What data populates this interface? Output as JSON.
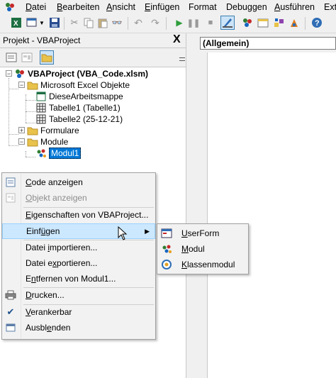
{
  "menubar": {
    "items": [
      {
        "label": "Datei",
        "u": "D",
        "rest": "atei"
      },
      {
        "label": "Bearbeiten",
        "u": "B",
        "rest": "earbeiten"
      },
      {
        "label": "Ansicht",
        "u": "A",
        "rest": "nsicht"
      },
      {
        "label": "Einfügen",
        "u": "E",
        "rest": "infügen"
      },
      {
        "label": "Format",
        "u": "",
        "rest": "Format"
      },
      {
        "label": "Debuggen",
        "u": "",
        "rest": "Debuggen"
      },
      {
        "label": "Ausführen",
        "u": "A",
        "rest": "usführen"
      },
      {
        "label": "Ext",
        "u": "",
        "rest": "Ext"
      }
    ]
  },
  "project": {
    "title": "Projekt - VBAProject",
    "close_glyph": "X"
  },
  "tree": {
    "root": "VBAProject (VBA_Code.xlsm)",
    "excel_objects": "Microsoft Excel Objekte",
    "workbook": "DieseArbeitsmappe",
    "sheet1": "Tabelle1 (Tabelle1)",
    "sheet2": "Tabelle2 (25-12-21)",
    "forms": "Formulare",
    "modules": "Module",
    "module1": "Modul1"
  },
  "code": {
    "object_combo": "(Allgemein)"
  },
  "context_menu": {
    "code_show": {
      "u": "C",
      "rest": "ode anzeigen"
    },
    "object_show": {
      "u": "O",
      "rest": "bjekt anzeigen"
    },
    "properties": {
      "pre": "",
      "u": "E",
      "rest": "igenschaften von VBAProject..."
    },
    "insert": {
      "pre": "Einf",
      "u": "ü",
      "rest": "gen"
    },
    "import": {
      "pre": "Datei ",
      "u": "i",
      "rest": "mportieren..."
    },
    "export": {
      "pre": "Datei e",
      "u": "x",
      "rest": "portieren..."
    },
    "remove": {
      "pre": "E",
      "u": "n",
      "rest": "tfernen von Modul1..."
    },
    "print": {
      "pre": "",
      "u": "D",
      "rest": "rucken..."
    },
    "dockable": {
      "pre": "",
      "u": "V",
      "rest": "erankerbar"
    },
    "hide": {
      "pre": "Ausbl",
      "u": "e",
      "rest": "nden"
    }
  },
  "submenu": {
    "userform": {
      "u": "U",
      "rest": "serForm"
    },
    "module": {
      "u": "M",
      "rest": "odul"
    },
    "classmodule": {
      "u": "K",
      "rest": "lassenmodul"
    }
  },
  "colors": {
    "selection": "#0078d7",
    "highlight": "#cce8ff",
    "folder": "#e8c24a"
  }
}
